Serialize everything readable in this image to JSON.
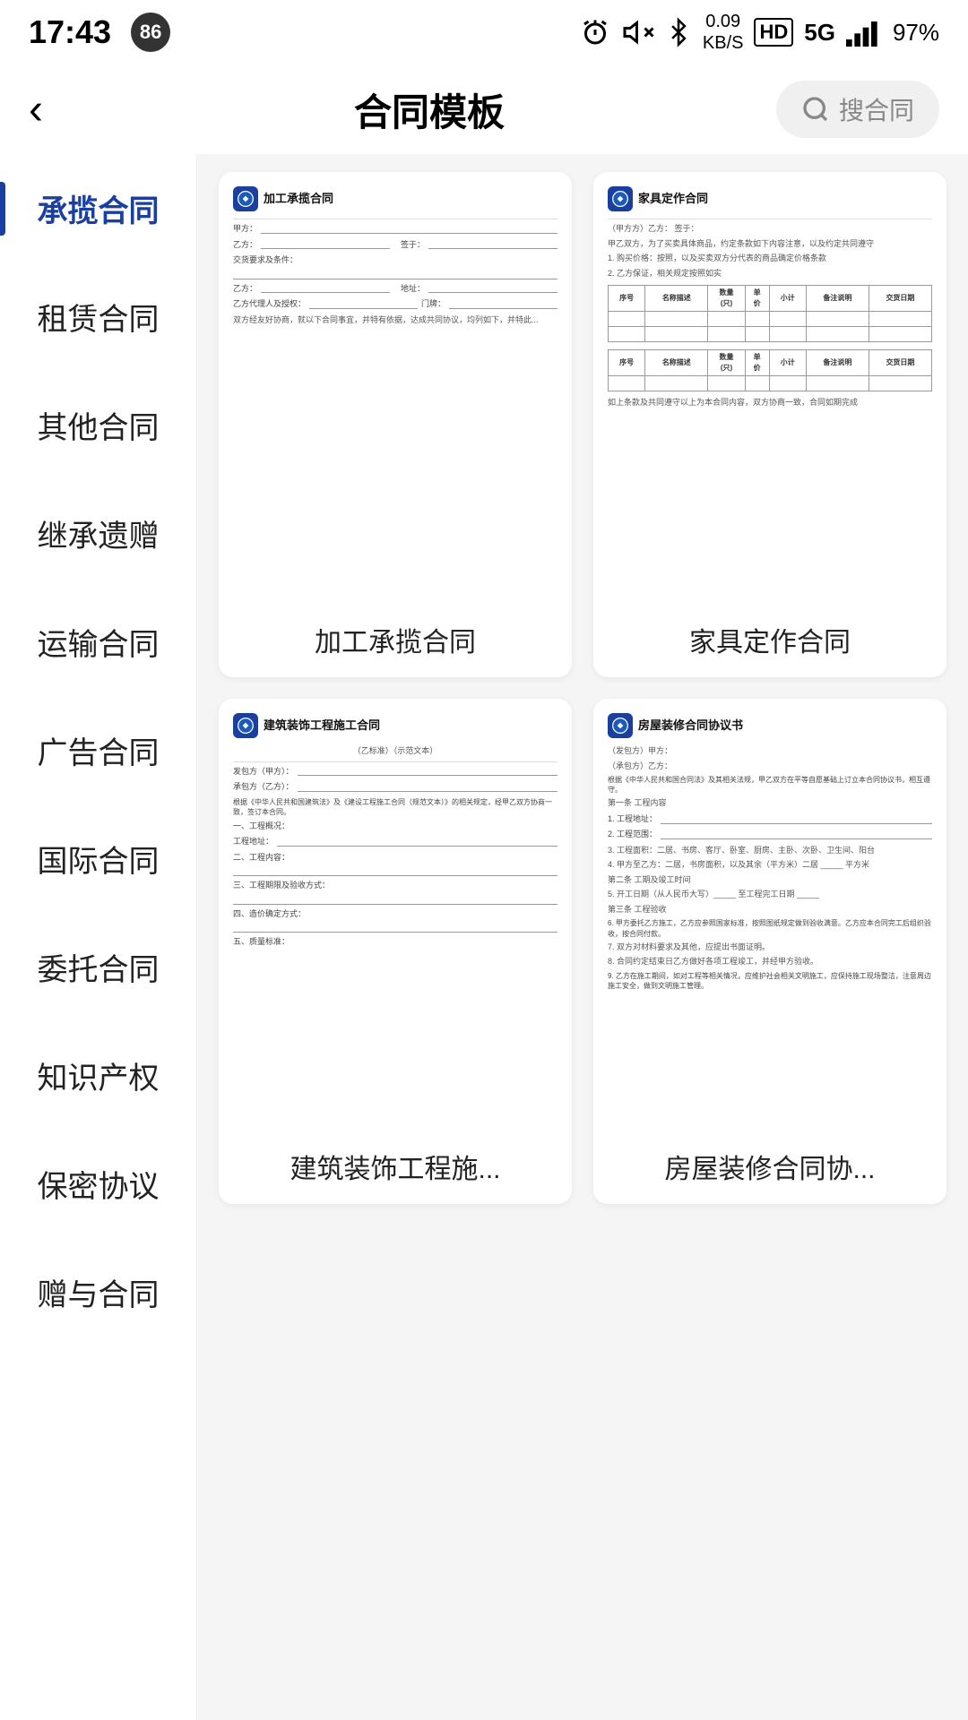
{
  "statusBar": {
    "time": "17:43",
    "badge": "86",
    "networkSpeed": "0.09\nKB/S",
    "quality": "HD",
    "signal": "5G",
    "battery": "97%"
  },
  "header": {
    "title": "合同模板",
    "backLabel": "‹",
    "searchPlaceholder": "搜合同"
  },
  "sidebar": {
    "items": [
      {
        "id": "chenglanbao",
        "label": "承揽合同",
        "active": true
      },
      {
        "id": "zulin",
        "label": "租赁合同",
        "active": false
      },
      {
        "id": "qita",
        "label": "其他合同",
        "active": false
      },
      {
        "id": "jicheng",
        "label": "继承遗赠",
        "active": false
      },
      {
        "id": "yunshu",
        "label": "运输合同",
        "active": false
      },
      {
        "id": "guanggao",
        "label": "广告合同",
        "active": false
      },
      {
        "id": "guoji",
        "label": "国际合同",
        "active": false
      },
      {
        "id": "weituo",
        "label": "委托合同",
        "active": false
      },
      {
        "id": "zhishichanquan",
        "label": "知识产权",
        "active": false
      },
      {
        "id": "baomi",
        "label": "保密协议",
        "active": false
      },
      {
        "id": "zengyuhetong",
        "label": "赠与合同",
        "active": false
      }
    ]
  },
  "contracts": [
    {
      "id": "jiagong",
      "title": "加工承揽合同",
      "logoText": "活",
      "docTitle": "加工承揽合同",
      "label": "加工承揽合同"
    },
    {
      "id": "jiaju",
      "title": "家具定作合同",
      "logoText": "活",
      "docTitle": "家具定作合同",
      "label": "家具定作合同"
    },
    {
      "id": "jianzhu",
      "title": "建筑装饰工程施...",
      "logoText": "活",
      "docTitle": "建筑装饰工程施工合同",
      "label": "建筑装饰工程施..."
    },
    {
      "id": "fangwu",
      "title": "房屋装修合同协...",
      "logoText": "活",
      "docTitle": "房屋装修合同协议书",
      "label": "房屋装修合同协..."
    }
  ]
}
